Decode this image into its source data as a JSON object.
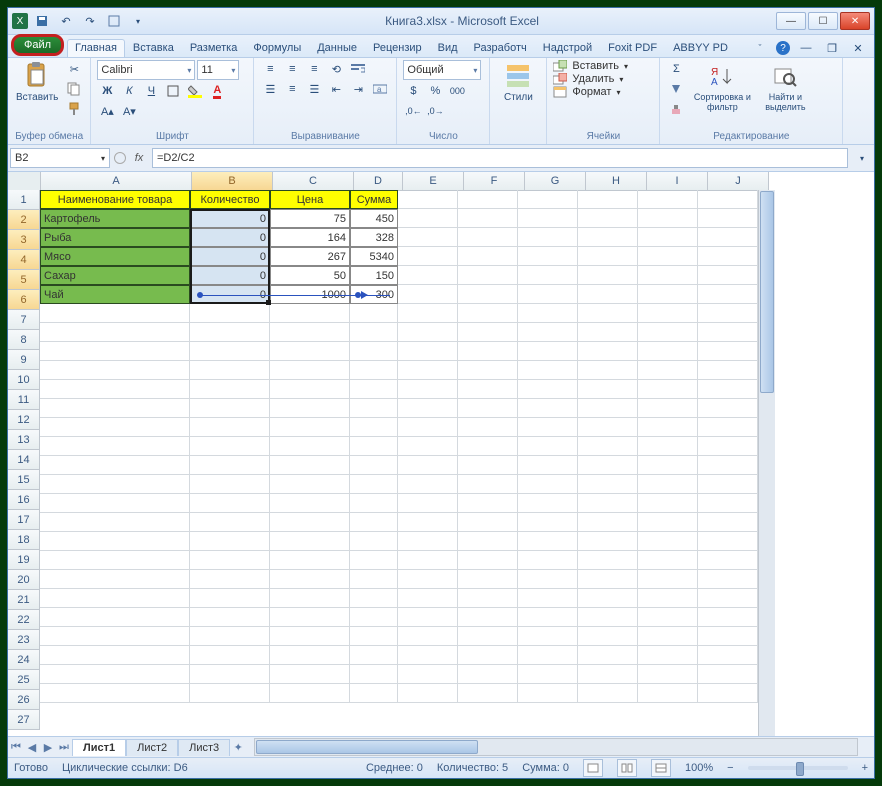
{
  "window": {
    "title": "Книга3.xlsx - Microsoft Excel"
  },
  "tabs": {
    "file": "Файл",
    "list": [
      "Главная",
      "Вставка",
      "Разметка",
      "Формулы",
      "Данные",
      "Рецензир",
      "Вид",
      "Разработч",
      "Надстрой",
      "Foxit PDF",
      "ABBYY PD"
    ]
  },
  "ribbon": {
    "paste": "Вставить",
    "clipboard": "Буфер обмена",
    "font_name": "Calibri",
    "font_size": "11",
    "font_group": "Шрифт",
    "align_group": "Выравнивание",
    "number_format": "Общий",
    "number_group": "Число",
    "styles": "Стили",
    "insert": "Вставить",
    "delete": "Удалить",
    "format": "Формат",
    "cells_group": "Ячейки",
    "sort": "Сортировка и фильтр",
    "find": "Найти и выделить",
    "editing_group": "Редактирование"
  },
  "fx": {
    "namebox": "B2",
    "formula": "=D2/C2"
  },
  "grid": {
    "cols": [
      {
        "letter": "A",
        "w": 150
      },
      {
        "letter": "B",
        "w": 80
      },
      {
        "letter": "C",
        "w": 80
      },
      {
        "letter": "D",
        "w": 48
      },
      {
        "letter": "E",
        "w": 60
      },
      {
        "letter": "F",
        "w": 60
      },
      {
        "letter": "G",
        "w": 60
      },
      {
        "letter": "H",
        "w": 60
      },
      {
        "letter": "I",
        "w": 60
      },
      {
        "letter": "J",
        "w": 60
      }
    ],
    "headers": [
      "Наименование товара",
      "Количество",
      "Цена",
      "Сумма"
    ],
    "rows": [
      {
        "name": "Картофель",
        "qty": "0",
        "price": "75",
        "sum": "450"
      },
      {
        "name": "Рыба",
        "qty": "0",
        "price": "164",
        "sum": "328"
      },
      {
        "name": "Мясо",
        "qty": "0",
        "price": "267",
        "sum": "5340"
      },
      {
        "name": "Сахар",
        "qty": "0",
        "price": "50",
        "sum": "150"
      },
      {
        "name": "Чай",
        "qty": "0",
        "price": "1000",
        "sum": "300"
      }
    ],
    "total_rows": 27
  },
  "sheets": {
    "list": [
      "Лист1",
      "Лист2",
      "Лист3"
    ],
    "active": 0
  },
  "status": {
    "ready": "Готово",
    "circ": "Циклические ссылки: D6",
    "avg": "Среднее: 0",
    "count": "Количество: 5",
    "sum": "Сумма: 0",
    "zoom": "100%"
  }
}
